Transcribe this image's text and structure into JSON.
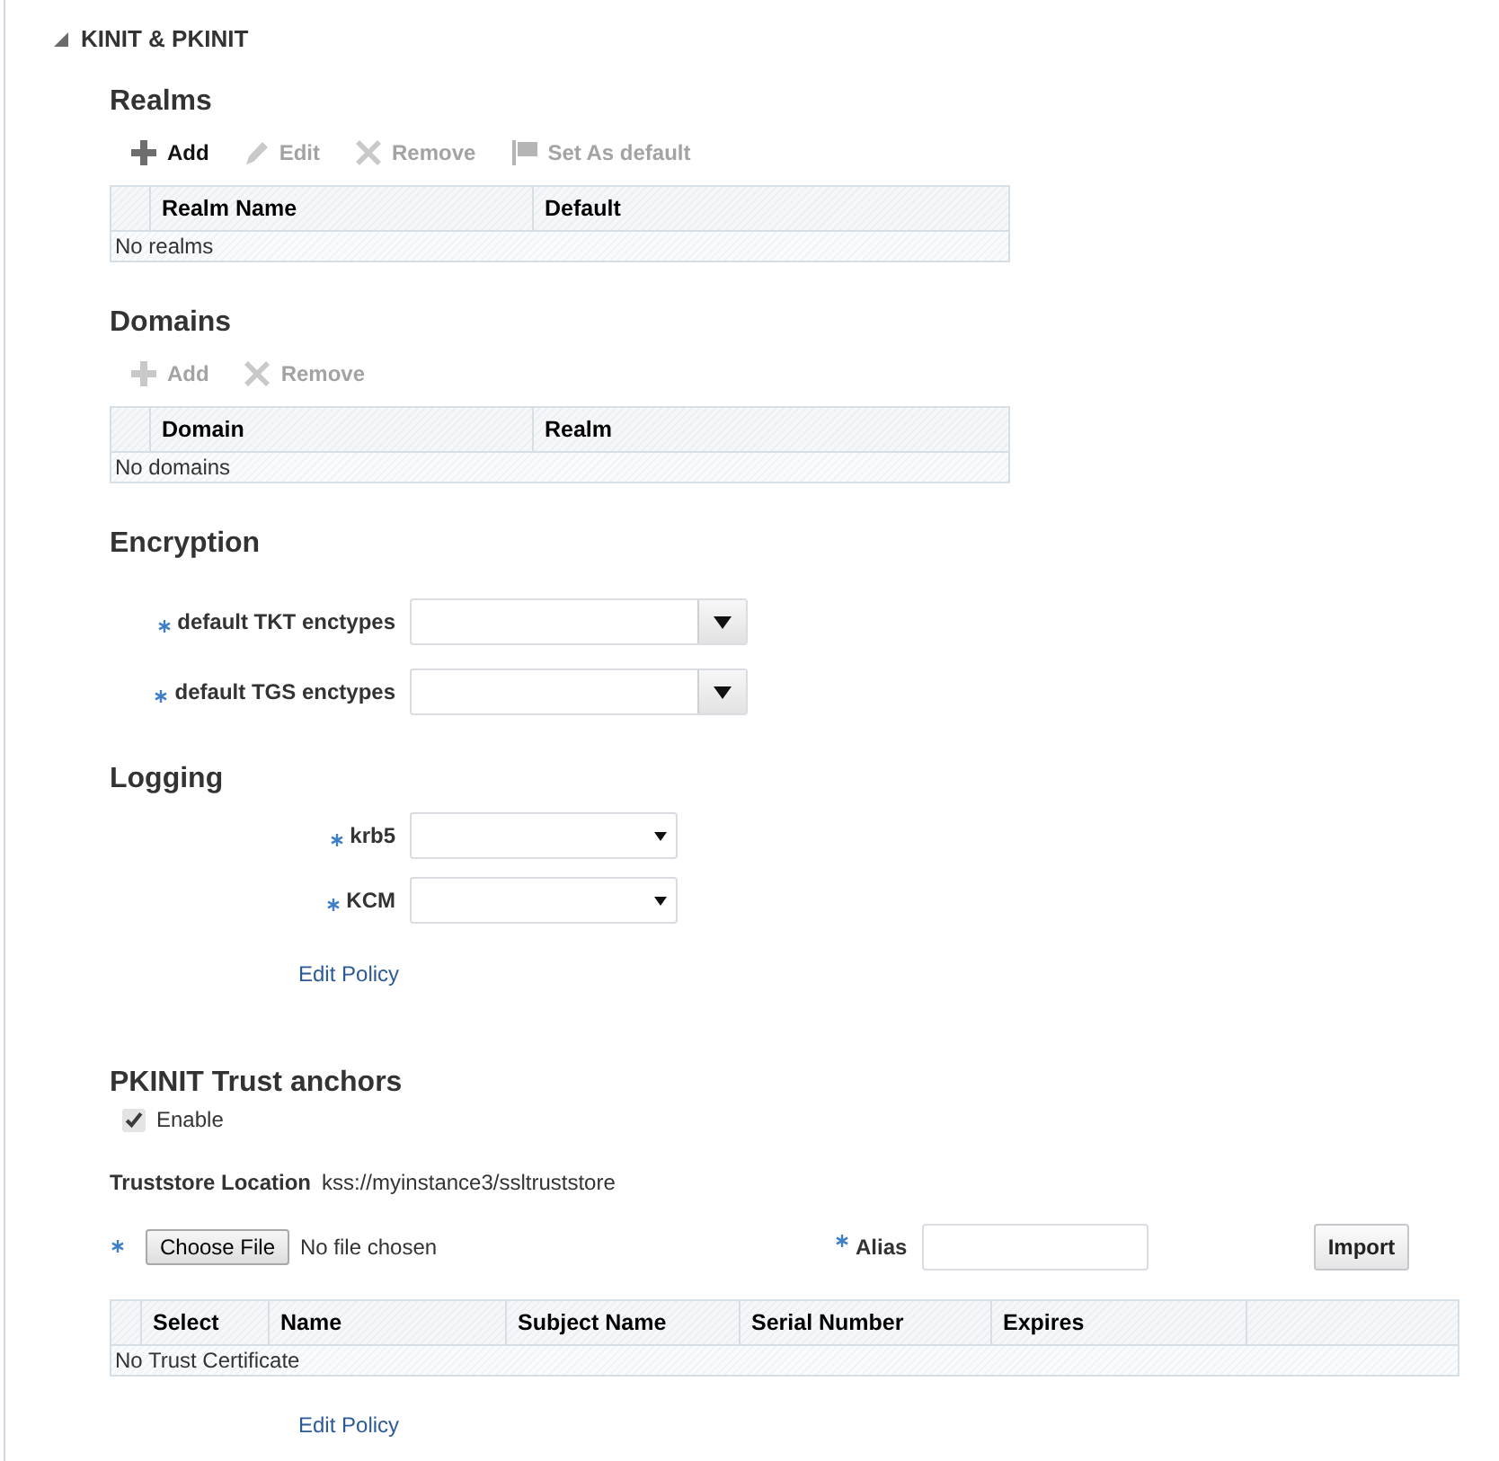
{
  "section": {
    "title": "KINIT & PKINIT",
    "expanded": true
  },
  "realms": {
    "title": "Realms",
    "toolbar": [
      {
        "kind": "add",
        "label": "Add",
        "disabled": false
      },
      {
        "kind": "edit",
        "label": "Edit",
        "disabled": true
      },
      {
        "kind": "remove",
        "label": "Remove",
        "disabled": true
      },
      {
        "kind": "flag",
        "label": "Set As default",
        "disabled": true
      }
    ],
    "table": {
      "columns": [
        "Realm Name",
        "Default"
      ],
      "empty_text": "No realms"
    }
  },
  "domains": {
    "title": "Domains",
    "toolbar": [
      {
        "kind": "add",
        "label": "Add",
        "disabled": true
      },
      {
        "kind": "remove",
        "label": "Remove",
        "disabled": true
      }
    ],
    "table": {
      "columns": [
        "Domain",
        "Realm"
      ],
      "empty_text": "No domains"
    }
  },
  "encryption": {
    "title": "Encryption",
    "fields": [
      {
        "kind": "combobox",
        "label": "default TKT enctypes",
        "required": true
      },
      {
        "kind": "combobox",
        "label": "default TGS enctypes",
        "required": true
      }
    ]
  },
  "logging": {
    "title": "Logging",
    "fields": [
      {
        "kind": "select",
        "label": "krb5",
        "required": true
      },
      {
        "kind": "select",
        "label": "KCM",
        "required": true
      }
    ],
    "link": "Edit Policy"
  },
  "trust_anchors": {
    "title": "PKINIT Trust anchors",
    "enable": {
      "label": "Enable",
      "checked": true
    },
    "truststore": {
      "label": "Truststore Location",
      "value": "kss://myinstance3/ssltruststore"
    },
    "file": {
      "required": true,
      "button": "Choose File",
      "status": "No file chosen"
    },
    "alias": {
      "label": "Alias",
      "required": true
    },
    "import_button": "Import",
    "table": {
      "columns": [
        "Select",
        "Name",
        "Subject Name",
        "Serial Number",
        "Expires"
      ],
      "empty_text": "No Trust Certificate"
    },
    "link": "Edit Policy"
  }
}
